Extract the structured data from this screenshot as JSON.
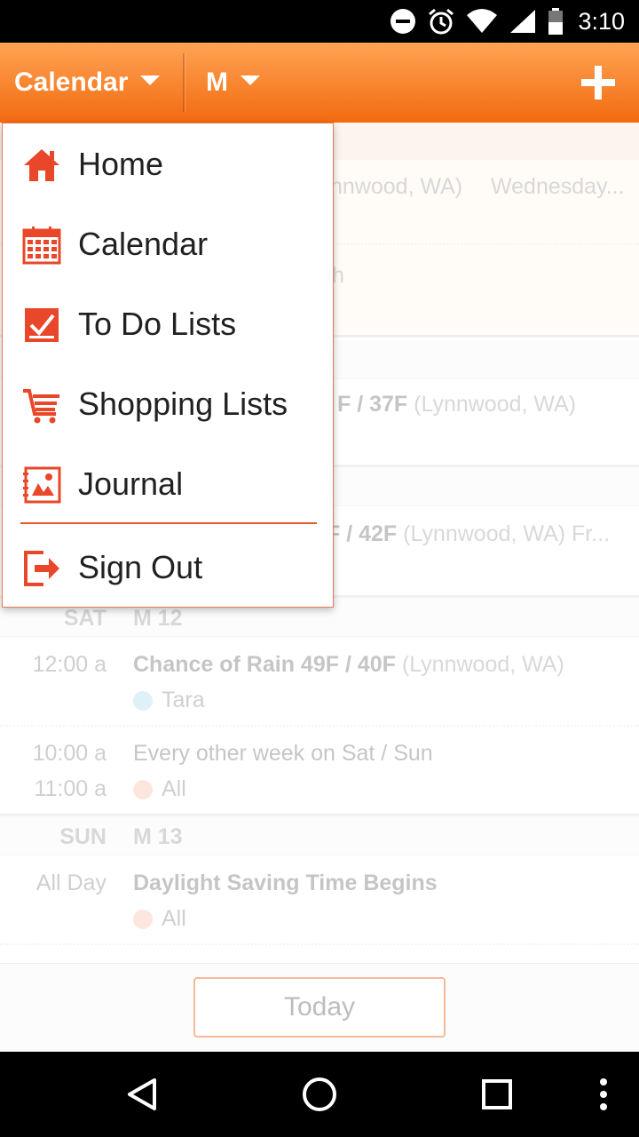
{
  "status_bar": {
    "time": "3:10"
  },
  "app_bar": {
    "view_selector": "Calendar",
    "member_selector": "M"
  },
  "menu": {
    "items": [
      {
        "label": "Home",
        "icon": "home-icon"
      },
      {
        "label": "Calendar",
        "icon": "calendar-icon"
      },
      {
        "label": "To Do Lists",
        "icon": "checkbox-icon"
      },
      {
        "label": "Shopping Lists",
        "icon": "cart-icon"
      },
      {
        "label": "Journal",
        "icon": "journal-icon"
      }
    ],
    "sign_out": {
      "label": "Sign Out",
      "icon": "sign-out-icon"
    }
  },
  "calendar": {
    "partial": {
      "loc_wed": "nnwood, WA)",
      "wed_tail": "Wednesday...",
      "h_tail": "h",
      "temp_1": "F / 37F",
      "loc_1": "(Lynnwood, WA)",
      "temp_2": "F / 42F",
      "loc_2": "(Lynnwood, WA)",
      "loc_2_tail": "Fr..."
    },
    "sat": {
      "day": "SAT",
      "date": "M 12",
      "events": [
        {
          "time": "12:00 a",
          "title": "Chance of Rain 49F / 40F",
          "location": "(Lynnwood, WA)",
          "person": "Tara"
        },
        {
          "time_start": "10:00 a",
          "time_end": "11:00 a",
          "title": "Every other week on Sat / Sun",
          "person": "All"
        }
      ]
    },
    "sun": {
      "day": "SUN",
      "date": "M 13",
      "events": [
        {
          "time": "All Day",
          "title": "Daylight Saving Time Begins",
          "person": "All"
        }
      ]
    }
  },
  "bottom": {
    "today_button": "Today"
  },
  "colors": {
    "accent": "#f26a10",
    "accent_light": "#ffa454",
    "menu_icon": "#e8472a",
    "dot_tara": "#8fd0e6",
    "dot_all": "#f7a98a"
  }
}
